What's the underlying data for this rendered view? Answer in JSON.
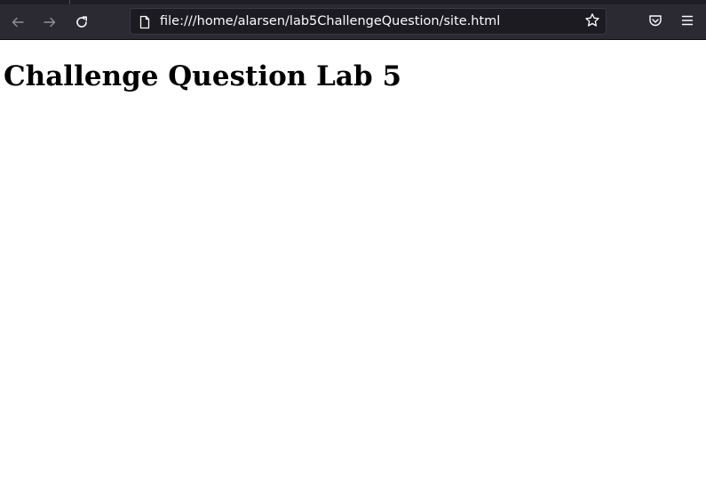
{
  "browser": {
    "url": "file:///home/alarsen/lab5ChallengeQuestion/site.html",
    "icons": {
      "back": "back-arrow-icon",
      "forward": "forward-arrow-icon",
      "reload": "reload-icon",
      "page": "page-icon",
      "bookmark": "star-icon",
      "pocket": "pocket-icon",
      "menu": "hamburger-menu-icon"
    },
    "colors": {
      "toolbar": "#2b2a33",
      "urlbar": "#1c1b22",
      "icon_active": "#fbfbfe",
      "icon_disabled": "#8f8f9d"
    }
  },
  "page": {
    "heading": "Challenge Question Lab 5"
  }
}
